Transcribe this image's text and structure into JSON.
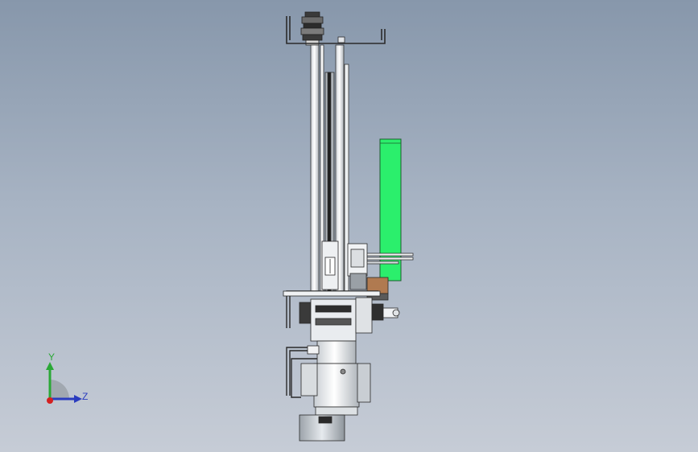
{
  "viewport": {
    "background_top": "#8797ab",
    "background_bottom": "#c6ccd6"
  },
  "triad": {
    "y_label": "Y",
    "z_label": "Z",
    "y_color": "#2aa836",
    "z_color": "#2a3cbf",
    "x_color": "#d42020"
  },
  "model": {
    "highlight_color": "#2bef6c",
    "accent_color": "#b07a50",
    "part_color": "#e8ecef"
  }
}
